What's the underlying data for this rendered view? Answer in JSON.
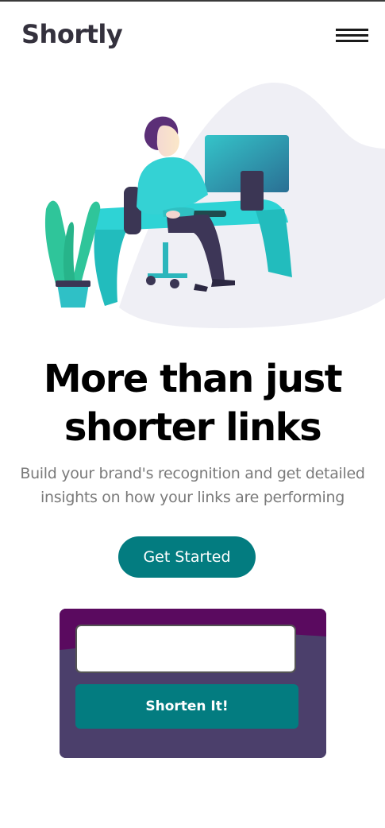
{
  "header": {
    "logo_text": "Shortly",
    "menu_icon": "hamburger-menu-icon"
  },
  "hero": {
    "illustration": "person-working-at-desk-illustration",
    "headline": "More than just shorter links",
    "subtext": "Build your brand's recognition and get detailed insights on how your links are performing",
    "cta_label": "Get Started"
  },
  "shorten": {
    "input_value": "",
    "input_placeholder": "",
    "button_label": "Shorten It!"
  },
  "colors": {
    "brand": "#037c80",
    "card_background": "#4b3f6b",
    "card_accent": "#5a0a5f",
    "logo": "#34313d",
    "subtext": "#7a7a7a"
  }
}
